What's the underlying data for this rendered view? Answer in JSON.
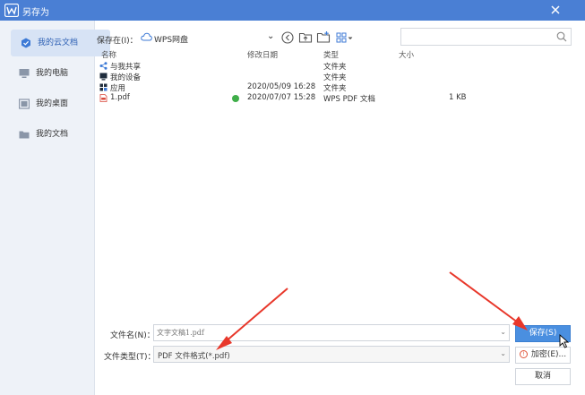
{
  "window": {
    "title": "另存为"
  },
  "sidebar": {
    "items": [
      {
        "label": "我的云文档",
        "active": true
      },
      {
        "label": "我的电脑"
      },
      {
        "label": "我的桌面"
      },
      {
        "label": "我的文档"
      }
    ]
  },
  "toolbar": {
    "save_in_label": "保存在(I)：",
    "location": "WPS网盘",
    "search_placeholder": ""
  },
  "file_list": {
    "headers": {
      "name": "名称",
      "modified": "修改日期",
      "type": "类型",
      "size": "大小"
    },
    "rows": [
      {
        "name": "与我共享",
        "modified": "",
        "type": "文件夹",
        "size": "",
        "icon": "share-icon"
      },
      {
        "name": "我的设备",
        "modified": "",
        "type": "文件夹",
        "size": "",
        "icon": "device-icon"
      },
      {
        "name": "应用",
        "modified": "2020/05/09 16:28",
        "type": "文件夹",
        "size": "",
        "icon": "app-icon"
      },
      {
        "name": "1.pdf",
        "modified": "2020/07/07 15:28",
        "type": "WPS PDF 文档",
        "size": "1 KB",
        "icon": "pdf-icon",
        "synced": true
      }
    ]
  },
  "form": {
    "filename_label": "文件名(N)：",
    "filename_value": "文字文稿1.pdf",
    "filetype_label": "文件类型(T)：",
    "filetype_value": "PDF 文件格式(*.pdf)"
  },
  "buttons": {
    "save": "保存(S)",
    "encrypt": "加密(E)...",
    "cancel": "取消"
  },
  "colors": {
    "titlebar": "#4a7fd4",
    "accent": "#4a8fe0",
    "annotation_arrow": "#e8372a"
  }
}
